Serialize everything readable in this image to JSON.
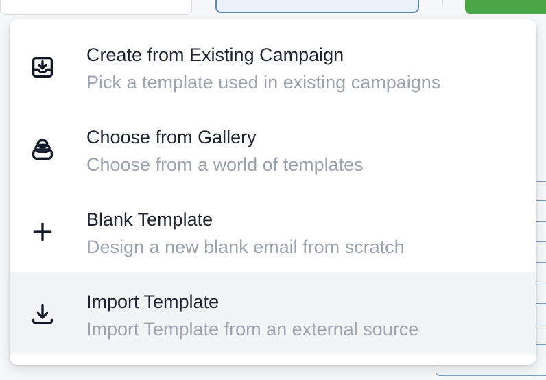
{
  "menu": {
    "items": [
      {
        "title": "Create from Existing Campaign",
        "description": "Pick a template used in existing campaigns",
        "icon": "inbox-download-icon"
      },
      {
        "title": "Choose from Gallery",
        "description": "Choose from a world of templates",
        "icon": "stack-icon"
      },
      {
        "title": "Blank Template",
        "description": "Design a new blank email from scratch",
        "icon": "plus-icon"
      },
      {
        "title": "Import Template",
        "description": "Import Template from an external source",
        "icon": "download-icon"
      }
    ]
  },
  "colors": {
    "highlight": "#f3f4f6",
    "title": "#1f2430",
    "description": "#9ca3af",
    "accent-blue": "#5a87c8",
    "accent-green": "#49a745"
  }
}
